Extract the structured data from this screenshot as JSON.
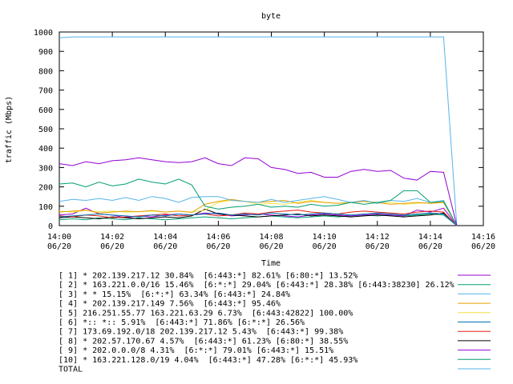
{
  "chart_data": {
    "type": "line",
    "title": "byte",
    "xlabel": "Time",
    "ylabel": "traffic (Mbps)",
    "xlim": [
      "14:00",
      "14:16"
    ],
    "ylim": [
      0,
      1000
    ],
    "grid": false,
    "legend": "below",
    "y_ticks": [
      "0",
      "100",
      "200",
      "300",
      "400",
      "500",
      "600",
      "700",
      "800",
      "900",
      "1000"
    ],
    "x_ticks": [
      {
        "minute": 0,
        "time": "14:00",
        "date": "06/20"
      },
      {
        "minute": 2,
        "time": "14:02",
        "date": "06/20"
      },
      {
        "minute": 4,
        "time": "14:04",
        "date": "06/20"
      },
      {
        "minute": 6,
        "time": "14:06",
        "date": "06/20"
      },
      {
        "minute": 8,
        "time": "14:08",
        "date": "06/20"
      },
      {
        "minute": 10,
        "time": "14:10",
        "date": "06/20"
      },
      {
        "minute": 12,
        "time": "14:12",
        "date": "06/20"
      },
      {
        "minute": 14,
        "time": "14:14",
        "date": "06/20"
      },
      {
        "minute": 16,
        "time": "14:16",
        "date": "06/20"
      }
    ],
    "x": [
      0,
      0.5,
      1,
      1.5,
      2,
      2.5,
      3,
      3.5,
      4,
      4.5,
      5,
      5.5,
      6,
      6.5,
      7,
      7.5,
      8,
      8.5,
      9,
      9.5,
      10,
      10.5,
      11,
      11.5,
      12,
      12.5,
      13,
      13.5,
      14,
      14.5,
      15
    ],
    "series": [
      {
        "name": "[ 1] * 202.139.217.12 30.84%  [6:443:*] 82.61% [6:80:*] 13.52%",
        "color": "#9400d3",
        "values": [
          320,
          310,
          330,
          320,
          335,
          340,
          350,
          340,
          330,
          325,
          330,
          350,
          320,
          310,
          350,
          345,
          300,
          290,
          270,
          275,
          250,
          250,
          280,
          290,
          280,
          285,
          245,
          235,
          280,
          275,
          0
        ]
      },
      {
        "name": "[ 2] * 163.221.0.0/16 15.46%  [6:*:*] 29.04% [6:443:*] 28.38% [6:443:38230] 26.12%",
        "color": "#009e73",
        "values": [
          215,
          220,
          200,
          225,
          205,
          215,
          240,
          225,
          215,
          240,
          210,
          100,
          85,
          95,
          100,
          110,
          95,
          100,
          95,
          110,
          100,
          105,
          120,
          110,
          120,
          130,
          180,
          180,
          120,
          125,
          0
        ]
      },
      {
        "name": "[ 3] * * 15.15%  [6:*:*] 63.34% [6:443:*] 24.84%",
        "color": "#56b4e9",
        "values": [
          125,
          135,
          130,
          140,
          130,
          145,
          130,
          150,
          140,
          120,
          145,
          150,
          150,
          130,
          125,
          120,
          135,
          120,
          130,
          140,
          150,
          135,
          120,
          130,
          115,
          130,
          125,
          140,
          120,
          130,
          0
        ]
      },
      {
        "name": "[ 4] * 202.139.217.149 7.56%  [6:443:*] 95.46%",
        "color": "#e69f00",
        "values": [
          70,
          75,
          80,
          65,
          70,
          75,
          72,
          78,
          70,
          75,
          68,
          110,
          125,
          135,
          125,
          120,
          125,
          130,
          115,
          125,
          120,
          115,
          120,
          125,
          120,
          110,
          115,
          120,
          115,
          120,
          0
        ]
      },
      {
        "name": "[ 5] 216.251.55.77 163.221.63.29 6.73%  [6:443:42822] 100.00%",
        "color": "#f0e442",
        "values": [
          75,
          70,
          78,
          72,
          75,
          70,
          72,
          75,
          70,
          75,
          70,
          80,
          120,
          130,
          125,
          110,
          115,
          110,
          120,
          130,
          120,
          115,
          118,
          125,
          115,
          120,
          110,
          115,
          120,
          118,
          0
        ]
      },
      {
        "name": "[ 6] *:: *:: 5.91%  [6:443:*] 71.86% [6:*:*] 26.56%",
        "color": "#0072b2",
        "values": [
          45,
          50,
          55,
          60,
          55,
          50,
          45,
          55,
          50,
          60,
          55,
          60,
          65,
          55,
          60,
          55,
          65,
          60,
          55,
          60,
          65,
          60,
          55,
          60,
          65,
          60,
          55,
          60,
          65,
          60,
          0
        ]
      },
      {
        "name": "[ 7] 173.69.192.0/18 202.139.217.12 5.43%  [6:443:*] 99.38%",
        "color": "#e51e10",
        "values": [
          50,
          45,
          55,
          50,
          40,
          45,
          50,
          55,
          60,
          50,
          55,
          60,
          50,
          55,
          65,
          60,
          70,
          75,
          80,
          70,
          65,
          60,
          70,
          75,
          70,
          65,
          60,
          70,
          75,
          70,
          0
        ]
      },
      {
        "name": "[ 8] * 202.57.170.67 4.57%  [6:443:*] 61.23% [6:80:*] 38.55%",
        "color": "#000000",
        "values": [
          40,
          45,
          40,
          35,
          45,
          40,
          35,
          40,
          45,
          40,
          50,
          85,
          60,
          55,
          50,
          45,
          50,
          55,
          60,
          50,
          55,
          50,
          45,
          50,
          55,
          50,
          45,
          50,
          55,
          65,
          0
        ]
      },
      {
        "name": "[ 9] * 202.0.0.0/8 4.31%  [6:*:*] 79.01% [6:443:*] 15.51%",
        "color": "#9400d3",
        "values": [
          55,
          60,
          90,
          60,
          55,
          40,
          50,
          45,
          55,
          60,
          55,
          65,
          60,
          50,
          55,
          60,
          55,
          50,
          45,
          55,
          60,
          55,
          50,
          55,
          60,
          55,
          50,
          80,
          70,
          90,
          0
        ]
      },
      {
        "name": "[10] * 163.221.128.0/19 4.04%  [6:443:*] 47.28% [6:*:*] 45.93%",
        "color": "#009e73",
        "values": [
          30,
          35,
          30,
          40,
          35,
          30,
          40,
          35,
          30,
          35,
          40,
          45,
          40,
          35,
          40,
          45,
          50,
          45,
          40,
          45,
          50,
          45,
          50,
          55,
          50,
          55,
          50,
          55,
          60,
          55,
          0
        ]
      },
      {
        "name": "TOTAL",
        "color": "#56b4e9",
        "values": [
          970,
          975,
          975,
          975,
          975,
          975,
          975,
          975,
          975,
          975,
          975,
          975,
          975,
          975,
          975,
          975,
          975,
          975,
          975,
          975,
          975,
          975,
          975,
          975,
          975,
          975,
          975,
          975,
          975,
          975,
          0
        ]
      }
    ]
  }
}
